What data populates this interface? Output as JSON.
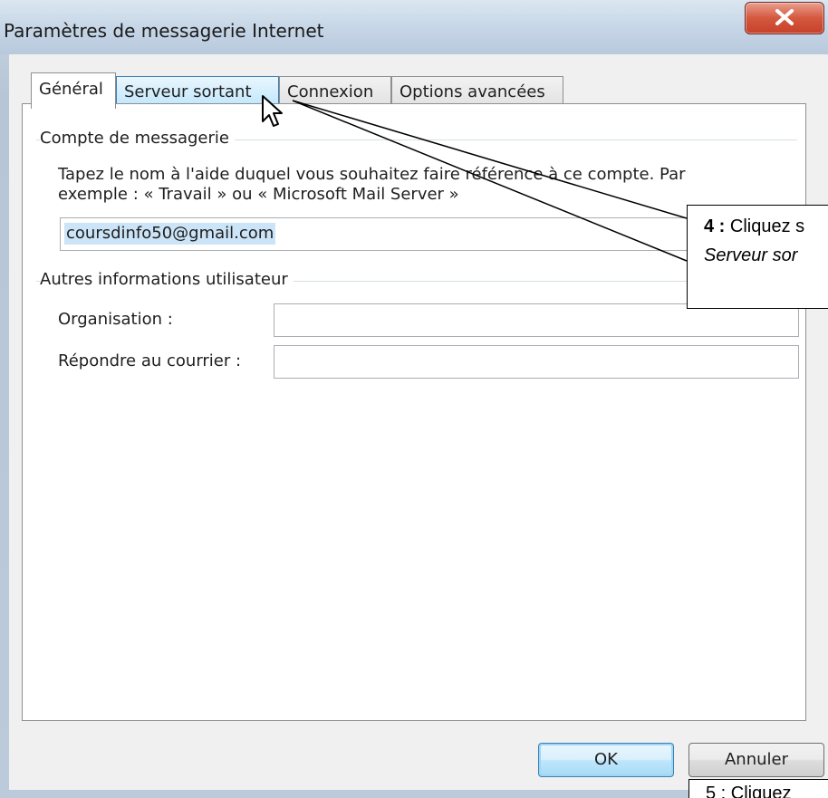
{
  "window": {
    "title": "Paramètres de messagerie Internet"
  },
  "tabs": [
    {
      "label": "Général"
    },
    {
      "label": "Serveur sortant"
    },
    {
      "label": "Connexion"
    },
    {
      "label": "Options avancées"
    }
  ],
  "account_group": {
    "title": "Compte de messagerie",
    "description_line1": "Tapez le nom à l'aide duquel vous souhaitez faire référence à ce compte. Par",
    "description_line2": "exemple : « Travail » ou « Microsoft Mail Server »",
    "account_name_value": "coursdinfo50@gmail.com"
  },
  "user_group": {
    "title": "Autres informations utilisateur",
    "organisation_label": "Organisation :",
    "organisation_value": "",
    "reply_label": "Répondre au courrier :",
    "reply_value": ""
  },
  "buttons": {
    "ok": "OK",
    "cancel": "Annuler"
  },
  "callouts": {
    "step4_number": "4 :",
    "step4_text": "Cliquez s",
    "step4_line2": "Serveur sor",
    "step5_text": "5 : Cliquez"
  },
  "icons": {
    "close": "close-icon",
    "cursor": "mouse-pointer-icon"
  }
}
